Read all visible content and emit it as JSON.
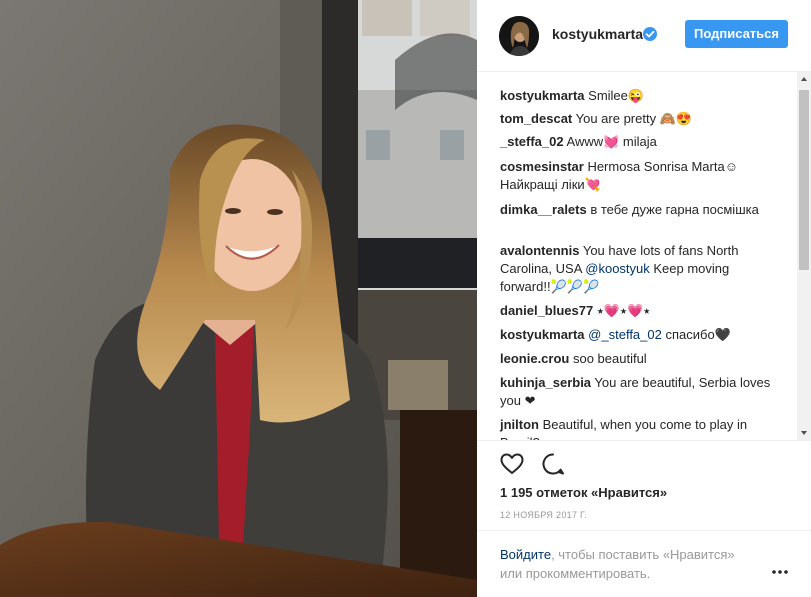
{
  "post": {
    "username": "kostyukmarta",
    "follow_label": "Подписаться",
    "likes_text": "1 195 отметок «Нравится»",
    "date_text": "12 НОЯБРЯ 2017 Г.",
    "login_link": "Войдите",
    "login_rest": ", чтобы поставить «Нравится» или прокомментировать.",
    "more_symbol": "•••"
  },
  "comments": [
    {
      "author": "kostyukmarta",
      "text": " Smilee😜"
    },
    {
      "author": "tom_descat",
      "text": " You are pretty 🙈😍"
    },
    {
      "author": "_steffa_02",
      "text": " Awww💓 milaja"
    },
    {
      "author": "cosmesinstar",
      "text": " Hermosa Sonrisa Marta☺ Найкращі ліки💘"
    },
    {
      "author": "dimka__ralets",
      "text": " в тебе дуже гарна посмішка"
    },
    {
      "author": "avalontennis",
      "pre": " You have lots of fans North Carolina, USA ",
      "mention": "@koostyuk",
      "post": " Keep moving forward!!🎾🎾🎾"
    },
    {
      "author": "daniel_blues77",
      "text": " ⭑💗⭑💗⭑"
    },
    {
      "author": "kostyukmarta",
      "pre": " ",
      "mention": "@_steffa_02",
      "post": " спасибо🖤"
    },
    {
      "author": "leonie.crou",
      "text": " soo beautiful"
    },
    {
      "author": "kuhinja_serbia",
      "text": " You are beautiful, Serbia loves you ❤"
    },
    {
      "author": "jnilton",
      "text": " Beautiful, when you come to play in Brazil?"
    }
  ],
  "icons": {
    "like": "heart-icon",
    "comment": "comment-bubble-icon",
    "verified": "verified-badge-icon",
    "more": "more-options-icon"
  },
  "colors": {
    "accent": "#3897f0",
    "link": "#003569",
    "muted": "#999999"
  }
}
